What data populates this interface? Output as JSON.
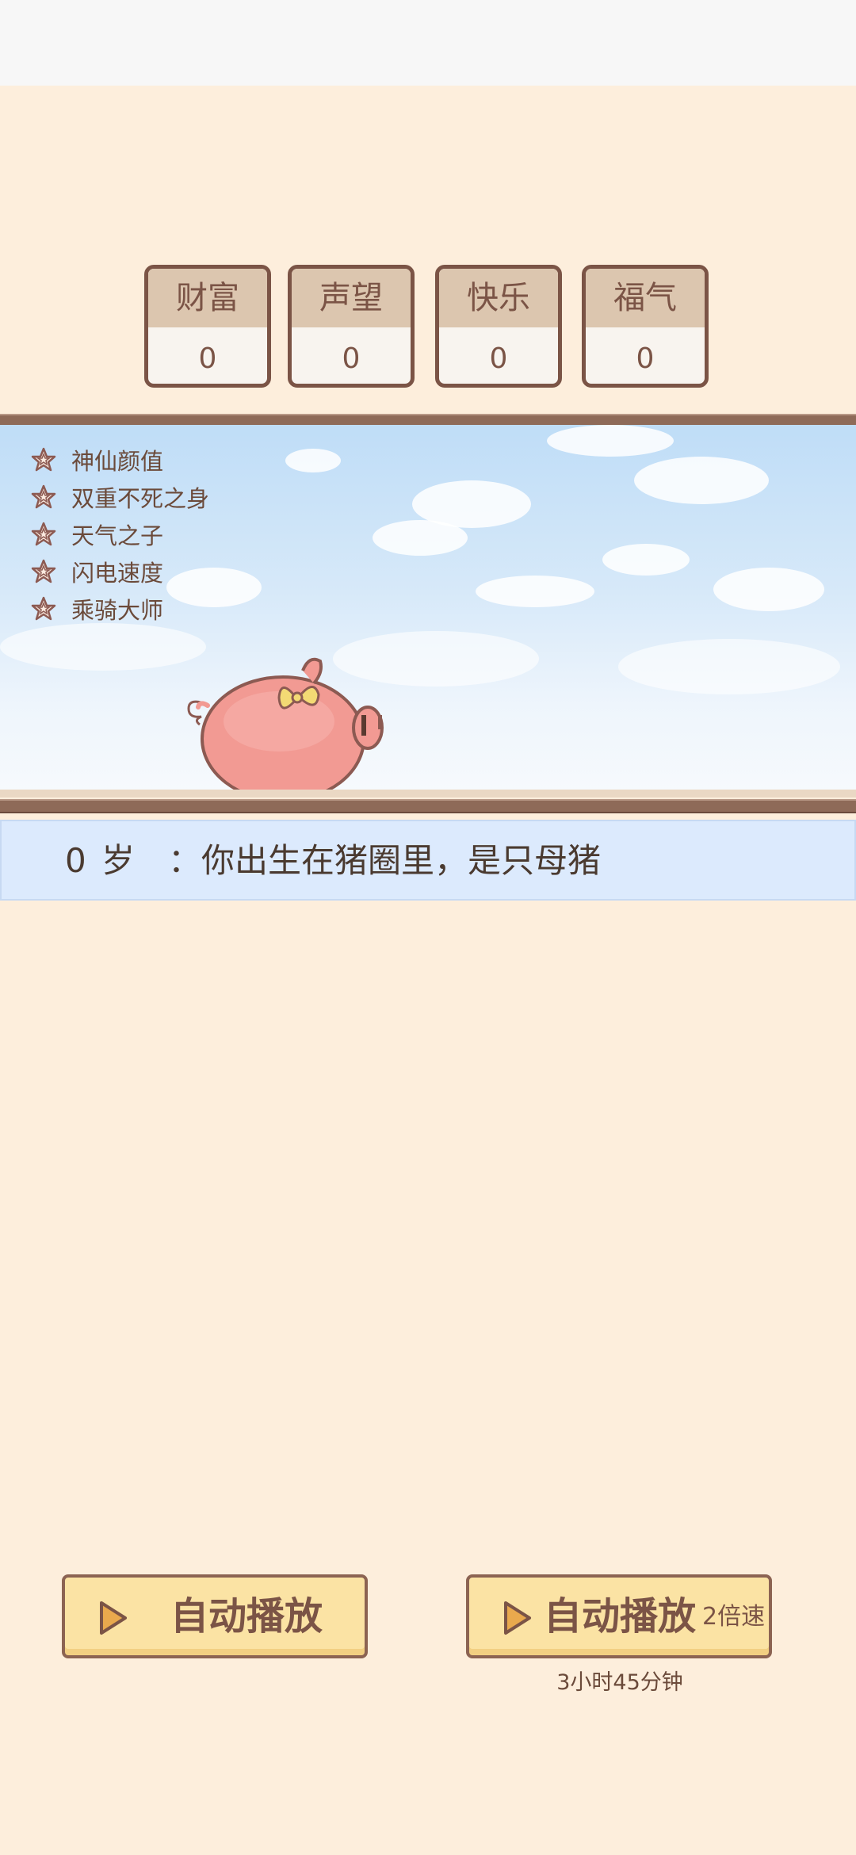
{
  "stats": [
    {
      "label": "财富",
      "value": "0"
    },
    {
      "label": "声望",
      "value": "0"
    },
    {
      "label": "快乐",
      "value": "0"
    },
    {
      "label": "福气",
      "value": "0"
    }
  ],
  "traits": [
    {
      "label": "神仙颜值",
      "icon": "star-outline-icon"
    },
    {
      "label": "双重不死之身",
      "icon": "star-outline-icon"
    },
    {
      "label": "天气之子",
      "icon": "star-outline-icon"
    },
    {
      "label": "闪电速度",
      "icon": "star-outline-icon"
    },
    {
      "label": "乘骑大师",
      "icon": "star-outline-icon"
    }
  ],
  "event": {
    "age": "0",
    "age_unit": "岁",
    "text": "：你出生在猪圈里，是只母猪"
  },
  "buttons": {
    "autoplay_label": "自动播放",
    "autoplay2x_label": "自动播放",
    "autoplay2x_speed": "2倍速",
    "autoplay2x_timer": "3小时45分钟"
  },
  "colors": {
    "background": "#FDEEDC",
    "brown": "#7B5446",
    "button_fill": "#FBE3A4",
    "event_bar": "#DCEAFD",
    "pig": "#F29A93"
  }
}
